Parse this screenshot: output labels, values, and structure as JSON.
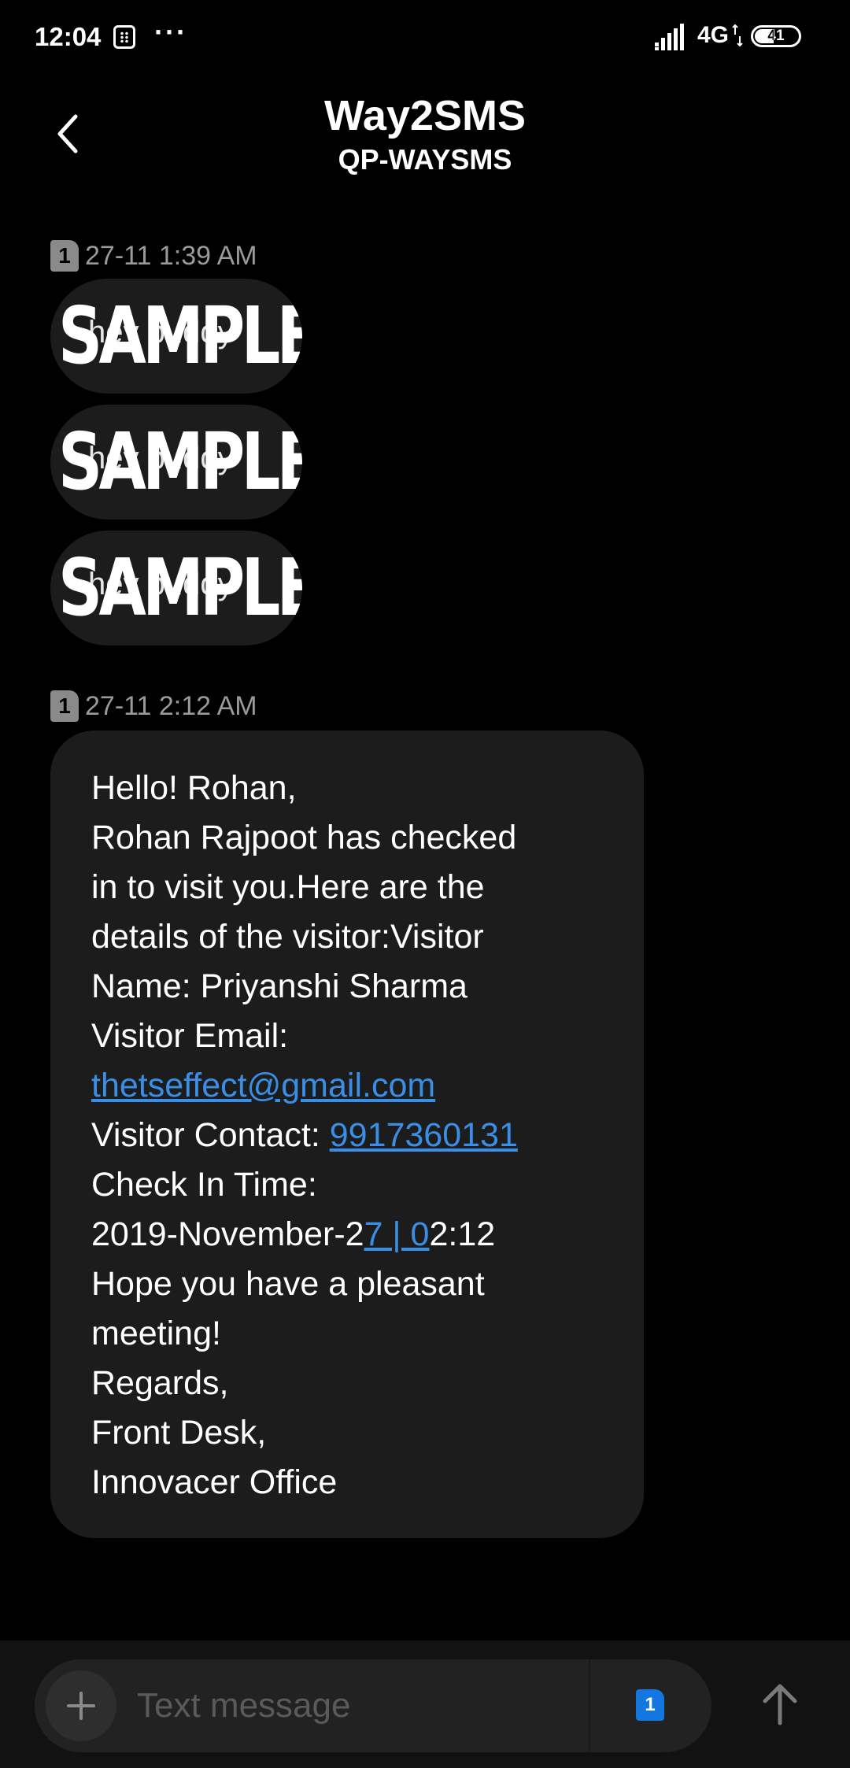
{
  "status_bar": {
    "time": "12:04",
    "more": "···",
    "network": "4G",
    "battery": "41"
  },
  "header": {
    "title": "Way2SMS",
    "subtitle": "QP-WAYSMS"
  },
  "messages": [
    {
      "sim": "1",
      "timestamp": "27-11 1:39 AM",
      "bubbles": [
        {
          "text": "hey buddy",
          "watermark": "SAMPLE"
        },
        {
          "text": "hey buddy",
          "watermark": "SAMPLE"
        },
        {
          "text": "hey buddy",
          "watermark": "SAMPLE"
        }
      ]
    },
    {
      "sim": "1",
      "timestamp": "27-11 2:12 AM",
      "lines": {
        "l1": "Hello! Rohan,",
        "l2": "Rohan Rajpoot has checked",
        "l3": "in to visit you.Here are the",
        "l4": "details of the visitor:Visitor",
        "l5": "Name: Priyanshi Sharma",
        "l6": "Visitor Email:",
        "email": "thetseffect@gmail.com",
        "contact_label": "Visitor Contact: ",
        "contact_number": "9917360131",
        "l9": "Check In Time:",
        "date_a": "2019-November-2",
        "date_link": "7 | 0",
        "date_b": "2:12",
        "l11": "Hope you have a pleasant",
        "l12": "meeting!",
        "l13": "Regards,",
        "l14": "Front Desk,",
        "l15": "Innovacer Office"
      }
    }
  ],
  "composer": {
    "placeholder": "Text message",
    "sim": "1"
  }
}
